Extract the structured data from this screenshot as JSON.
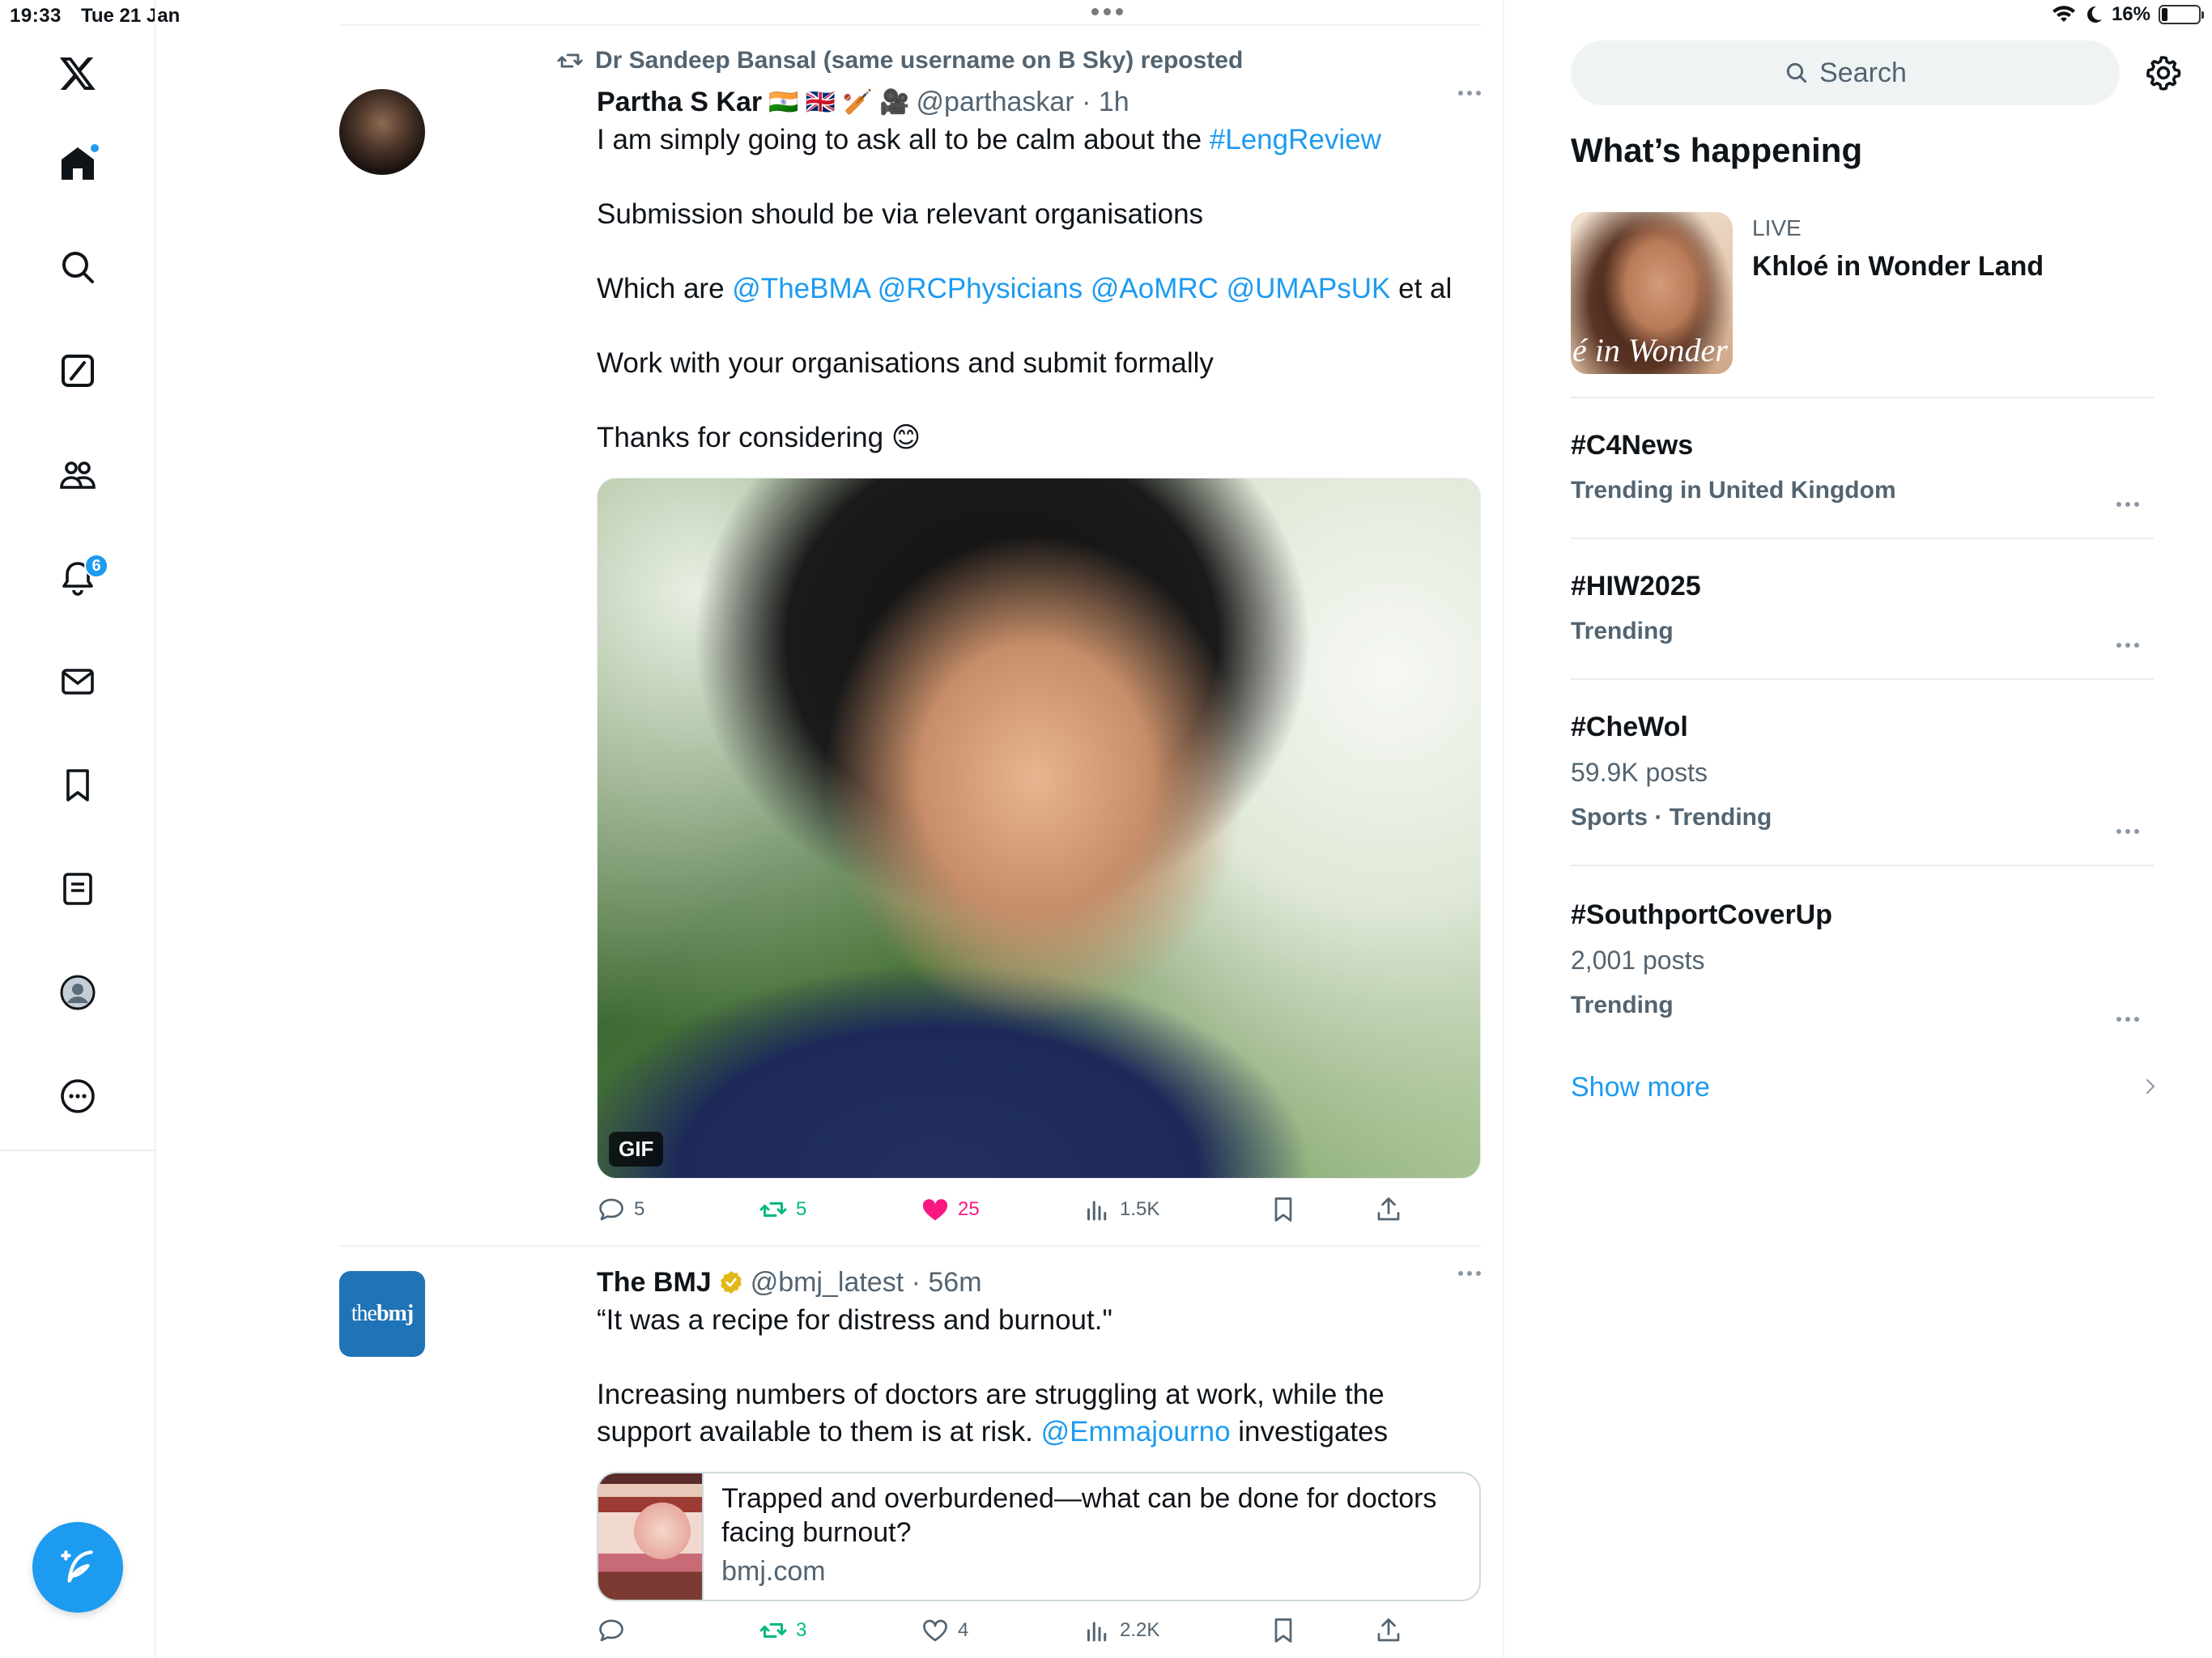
{
  "status_bar": {
    "time": "19:33",
    "date": "Tue 21 Jan",
    "battery": "16%",
    "battery_level": 0.16
  },
  "nav": {
    "notifications_badge": "6",
    "items": [
      "home",
      "explore",
      "grok",
      "communities",
      "notifications",
      "messages",
      "bookmarks",
      "lists",
      "profile",
      "more"
    ]
  },
  "timeline": {
    "tweets": [
      {
        "social_context": "Dr Sandeep Bansal (same username on B Sky) reposted",
        "name": "Partha S Kar",
        "flags": "🇮🇳 🇬🇧 🏏 🎥",
        "handle_time": "@parthaskar · 1h",
        "text_1_pre": "I am simply going to ask all to be calm about the ",
        "hashtag": "#LengReview",
        "text_2": "Submission should be via relevant organisations",
        "text_3_pre": "Which are ",
        "mentions": "@TheBMA @RCPhysicians @AoMRC @UMAPsUK",
        "text_3_post": " et al",
        "text_4": "Work with your organisations and submit formally",
        "text_5": "Thanks for considering 😊",
        "media_label": "GIF",
        "replies": "5",
        "reposts": "5",
        "likes": "25",
        "views": "1.5K"
      },
      {
        "name": "The BMJ",
        "handle_time": "@bmj_latest · 56m",
        "avatar_text_light": "the",
        "avatar_text_bold": "bmj",
        "text_1": "“It was a recipe for distress and burnout.\"",
        "text_2_pre": "Increasing numbers of doctors are struggling at work, while the support available to them is at risk. ",
        "mention": "@Emmajourno",
        "text_2_post": " investigates",
        "card_title": "Trapped and overburdened—what can be done for doctors facing burnout?",
        "card_domain": "bmj.com",
        "replies": "",
        "reposts": "3",
        "likes": "4",
        "views": "2.2K"
      }
    ]
  },
  "sidebar": {
    "search_placeholder": "Search",
    "section_title": "What’s happening",
    "live": {
      "label": "LIVE",
      "title": "Khloé in Wonder Land",
      "thumb_text": "é in Wonder L"
    },
    "trends": [
      {
        "tag": "#C4News",
        "posts": "",
        "context": "Trending in United Kingdom"
      },
      {
        "tag": "#HIW2025",
        "posts": "",
        "context": "Trending"
      },
      {
        "tag": "#CheWol",
        "posts": "59.9K posts",
        "context": "Sports · Trending"
      },
      {
        "tag": "#SouthportCoverUp",
        "posts": "2,001 posts",
        "context": "Trending"
      }
    ],
    "show_more": "Show more"
  },
  "colors": {
    "accent": "#1d9bf0",
    "repost_green": "#00ba7c",
    "like_pink": "#f91880",
    "secondary_text": "#536471"
  }
}
